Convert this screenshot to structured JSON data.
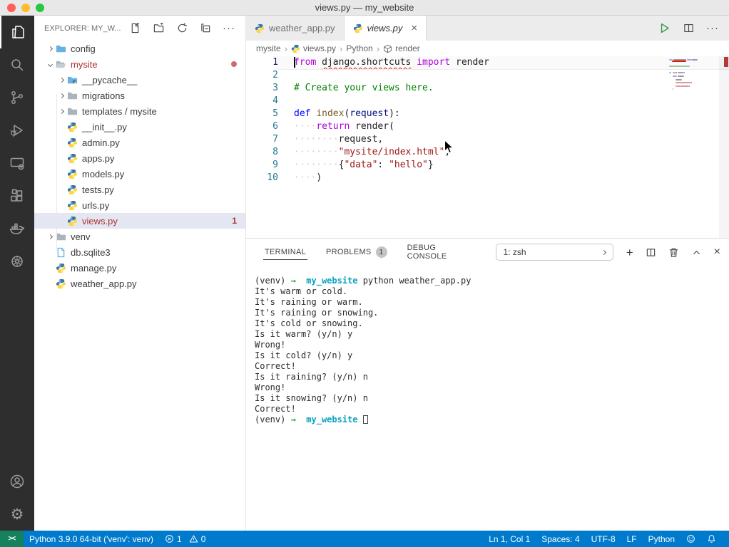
{
  "window": {
    "title": "views.py — my_website"
  },
  "activity_bar": {
    "top": [
      {
        "name": "explorer",
        "active": true
      },
      {
        "name": "search",
        "active": false
      },
      {
        "name": "source-control",
        "active": false
      },
      {
        "name": "run-debug",
        "active": false
      },
      {
        "name": "remote-explorer",
        "active": false
      },
      {
        "name": "extensions",
        "active": false
      },
      {
        "name": "docker",
        "active": false
      },
      {
        "name": "wheel",
        "active": false
      }
    ],
    "bottom": [
      {
        "name": "account",
        "active": false
      },
      {
        "name": "settings",
        "active": false
      }
    ]
  },
  "sidebar": {
    "header": {
      "title": "EXPLORER: MY_W...",
      "actions": [
        "new-file",
        "new-folder",
        "refresh",
        "collapse-all",
        "more"
      ]
    },
    "tree": [
      {
        "label": "config",
        "depth": 0,
        "kind": "folder",
        "icon": "folder-blue",
        "expanded": false
      },
      {
        "label": "mysite",
        "depth": 0,
        "kind": "folder",
        "icon": "folder-open",
        "expanded": true,
        "error": true,
        "dot": true
      },
      {
        "label": "__pycache__",
        "depth": 1,
        "kind": "folder",
        "icon": "folder-python",
        "expanded": false
      },
      {
        "label": "migrations",
        "depth": 1,
        "kind": "folder",
        "icon": "folder-gray",
        "expanded": false
      },
      {
        "label": "templates / mysite",
        "depth": 1,
        "kind": "folder",
        "icon": "folder-gray",
        "expanded": false
      },
      {
        "label": "__init__.py",
        "depth": 1,
        "kind": "file",
        "icon": "python"
      },
      {
        "label": "admin.py",
        "depth": 1,
        "kind": "file",
        "icon": "python"
      },
      {
        "label": "apps.py",
        "depth": 1,
        "kind": "file",
        "icon": "python"
      },
      {
        "label": "models.py",
        "depth": 1,
        "kind": "file",
        "icon": "python"
      },
      {
        "label": "tests.py",
        "depth": 1,
        "kind": "file",
        "icon": "python"
      },
      {
        "label": "urls.py",
        "depth": 1,
        "kind": "file",
        "icon": "python"
      },
      {
        "label": "views.py",
        "depth": 1,
        "kind": "file",
        "icon": "python",
        "selected": true,
        "error": true,
        "badge": "1"
      },
      {
        "label": "venv",
        "depth": 0,
        "kind": "folder",
        "icon": "folder-gray",
        "expanded": false
      },
      {
        "label": "db.sqlite3",
        "depth": 0,
        "kind": "file",
        "icon": "database"
      },
      {
        "label": "manage.py",
        "depth": 0,
        "kind": "file",
        "icon": "python"
      },
      {
        "label": "weather_app.py",
        "depth": 0,
        "kind": "file",
        "icon": "python"
      }
    ]
  },
  "editor": {
    "tabs": [
      {
        "label": "weather_app.py",
        "icon": "python",
        "active": false,
        "italic": false,
        "close": false
      },
      {
        "label": "views.py",
        "icon": "python",
        "active": true,
        "italic": true,
        "close": true
      }
    ],
    "actions": [
      "run",
      "split-editor",
      "more"
    ],
    "breadcrumb": [
      {
        "label": "mysite"
      },
      {
        "label": "views.py",
        "icon": "python"
      },
      {
        "label": "Python"
      },
      {
        "label": "render",
        "icon": "symbol-cube"
      }
    ],
    "code": {
      "lines": [
        {
          "num": "1",
          "current": true,
          "error": true,
          "tokens": [
            {
              "t": "from",
              "c": "kw"
            },
            {
              "t": " ",
              "c": "p"
            },
            {
              "t": "django.shortcuts",
              "c": "p sq"
            },
            {
              "t": " ",
              "c": "p"
            },
            {
              "t": "import",
              "c": "kw"
            },
            {
              "t": " render",
              "c": "p"
            }
          ]
        },
        {
          "num": "2",
          "tokens": []
        },
        {
          "num": "3",
          "tokens": [
            {
              "t": "# Create your views here.",
              "c": "cm"
            }
          ]
        },
        {
          "num": "4",
          "tokens": []
        },
        {
          "num": "5",
          "tokens": [
            {
              "t": "def",
              "c": "kw2"
            },
            {
              "t": " ",
              "c": "p"
            },
            {
              "t": "index",
              "c": "fn"
            },
            {
              "t": "(",
              "c": "p"
            },
            {
              "t": "request",
              "c": "pa"
            },
            {
              "t": "):",
              "c": "p"
            }
          ]
        },
        {
          "num": "6",
          "tokens": [
            {
              "t": "····",
              "c": "ws"
            },
            {
              "t": "return",
              "c": "kw"
            },
            {
              "t": " render(",
              "c": "p"
            }
          ]
        },
        {
          "num": "7",
          "tokens": [
            {
              "t": "········",
              "c": "ws"
            },
            {
              "t": "request,",
              "c": "p"
            }
          ]
        },
        {
          "num": "8",
          "tokens": [
            {
              "t": "········",
              "c": "ws"
            },
            {
              "t": "\"mysite/index.html\"",
              "c": "st"
            },
            {
              "t": ",",
              "c": "p"
            }
          ]
        },
        {
          "num": "9",
          "tokens": [
            {
              "t": "········",
              "c": "ws"
            },
            {
              "t": "{",
              "c": "p"
            },
            {
              "t": "\"data\"",
              "c": "st"
            },
            {
              "t": ": ",
              "c": "p"
            },
            {
              "t": "\"hello\"",
              "c": "st"
            },
            {
              "t": "}",
              "c": "p"
            }
          ]
        },
        {
          "num": "10",
          "tokens": [
            {
              "t": "····",
              "c": "ws"
            },
            {
              "t": ")",
              "c": "p"
            }
          ]
        }
      ]
    }
  },
  "panel": {
    "tabs": [
      {
        "label": "TERMINAL",
        "active": true
      },
      {
        "label": "PROBLEMS",
        "badge": "1"
      },
      {
        "label": "DEBUG CONSOLE"
      }
    ],
    "shell_select": {
      "value": "1: zsh"
    },
    "actions": [
      "add",
      "split",
      "trash",
      "chevron-up",
      "close"
    ],
    "terminal": {
      "lines": [
        [
          {
            "t": "(venv) "
          },
          {
            "t": "→",
            "c": "g"
          },
          {
            "t": "  "
          },
          {
            "t": "my_website",
            "c": "c"
          },
          {
            "t": " python weather_app.py"
          }
        ],
        [
          {
            "t": "It's warm or cold."
          }
        ],
        [
          {
            "t": "It's raining or warm."
          }
        ],
        [
          {
            "t": "It's raining or snowing."
          }
        ],
        [
          {
            "t": "It's cold or snowing."
          }
        ],
        [
          {
            "t": "Is it warm? (y/n) y"
          }
        ],
        [
          {
            "t": "Wrong!"
          }
        ],
        [
          {
            "t": "Is it cold? (y/n) y"
          }
        ],
        [
          {
            "t": "Correct!"
          }
        ],
        [
          {
            "t": "Is it raining? (y/n) n"
          }
        ],
        [
          {
            "t": "Wrong!"
          }
        ],
        [
          {
            "t": "Is it snowing? (y/n) n"
          }
        ],
        [
          {
            "t": "Correct!"
          }
        ],
        [
          {
            "t": "(venv) "
          },
          {
            "t": "→",
            "c": "g"
          },
          {
            "t": "  "
          },
          {
            "t": "my_website",
            "c": "c"
          },
          {
            "t": " "
          },
          {
            "t": "",
            "c": "cursor"
          }
        ]
      ]
    }
  },
  "status_bar": {
    "remote_label": "><",
    "items_left": [
      {
        "name": "python-interpreter",
        "label": "Python 3.9.0 64-bit ('venv': venv)"
      },
      {
        "name": "problems",
        "error": "1",
        "warning": "0"
      }
    ],
    "items_right": [
      {
        "name": "cursor-position",
        "label": "Ln 1, Col 1"
      },
      {
        "name": "indentation",
        "label": "Spaces: 4"
      },
      {
        "name": "encoding",
        "label": "UTF-8"
      },
      {
        "name": "eol",
        "label": "LF"
      },
      {
        "name": "language-mode",
        "label": "Python"
      },
      {
        "name": "feedback",
        "icon": "feedback"
      },
      {
        "name": "notifications",
        "icon": "bell"
      }
    ]
  },
  "colors": {
    "accent": "#007acc",
    "remote_green": "#16825d",
    "error_red": "#b03030",
    "keyword_purple": "#af00db",
    "keyword_blue": "#0000ff",
    "string_red": "#a31515",
    "comment_green": "#008000",
    "terminal_green": "#2aa32a",
    "terminal_cyan": "#0aa2c0",
    "traffic": [
      "#ff5f57",
      "#febc2e",
      "#28c840"
    ]
  }
}
